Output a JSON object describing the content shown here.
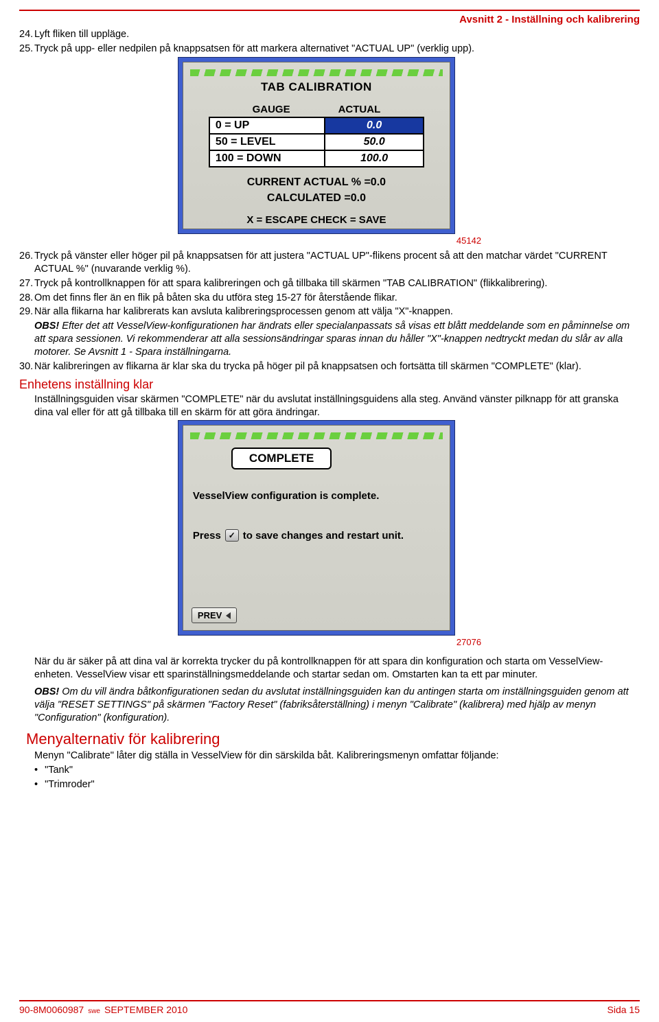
{
  "header": {
    "section_title": "Avsnitt 2 - Inställning och kalibrering"
  },
  "steps_a": [
    {
      "n": "24.",
      "text": "Lyft fliken till uppläge."
    },
    {
      "n": "25.",
      "text": "Tryck på upp- eller nedpilen på knappsatsen för att markera alternativet \"ACTUAL UP\" (verklig upp)."
    }
  ],
  "screen1": {
    "title": "TAB CALIBRATION",
    "col_gauge": "GAUGE",
    "col_actual": "ACTUAL",
    "rows": [
      {
        "left": "0 = UP",
        "right": "0.0",
        "selected": true
      },
      {
        "left": "50 = LEVEL",
        "right": "50.0",
        "selected": false
      },
      {
        "left": "100 = DOWN",
        "right": "100.0",
        "selected": false
      }
    ],
    "line_current": "CURRENT ACTUAL % =0.0",
    "line_calc": "CALCULATED =0.0",
    "footer": "X = ESCAPE  CHECK = SAVE",
    "fig_id": "45142"
  },
  "steps_b": [
    {
      "n": "26.",
      "text": "Tryck på vänster eller höger pil på knappsatsen för att justera \"ACTUAL UP\"-flikens procent så att den matchar värdet \"CURRENT ACTUAL %\" (nuvarande verklig %)."
    },
    {
      "n": "27.",
      "text": "Tryck på kontrollknappen för att spara kalibreringen och gå tillbaka till skärmen \"TAB CALIBRATION\" (flikkalibrering)."
    },
    {
      "n": "28.",
      "text": "Om det finns fler än en flik på båten ska du utföra steg 15-27 för återstående flikar."
    },
    {
      "n": "29.",
      "text": "När alla flikarna har kalibrerats kan avsluta kalibreringsprocessen genom att välja \"X\"-knappen."
    }
  ],
  "note1": {
    "obs": "OBS!",
    "text": " Efter det att VesselView-konfigurationen har ändrats eller specialanpassats så visas ett blått meddelande som en påminnelse om att spara sessionen. Vi rekommenderar att alla sessionsändringar sparas innan du håller \"X\"-knappen nedtryckt medan du slår av alla motorer. Se Avsnitt 1 - Spara inställningarna."
  },
  "step30": {
    "n": "30.",
    "text": "När kalibreringen av flikarna är klar ska du trycka på höger pil på knappsatsen och fortsätta till skärmen \"COMPLETE\" (klar)."
  },
  "h_enhetens": "Enhetens inställning klar",
  "para_enhetens": "Inställningsguiden visar skärmen \"COMPLETE\" när du avslutat inställningsguidens alla steg. Använd vänster pilknapp för att granska dina val eller för att gå tillbaka till en skärm för att göra ändringar.",
  "screen2": {
    "title": "COMPLETE",
    "body": "VesselView configuration is complete.",
    "press": "Press",
    "press_after": "to save changes and restart unit.",
    "prev": "PREV",
    "fig_id": "27076"
  },
  "para_after_complete": "När du är säker på att dina val är korrekta trycker du på kontrollknappen för att spara din konfiguration och starta om VesselView-enheten. VesselView visar ett sparinställningsmeddelande och startar sedan om. Omstarten kan ta ett par minuter.",
  "note2": {
    "obs": "OBS!",
    "text": " Om du vill ändra båtkonfigurationen sedan du avslutat inställningsguiden kan du antingen starta om inställningsguiden genom att välja \"RESET SETTINGS\" på skärmen \"Factory Reset\" (fabriksåterställning) i menyn \"Calibrate\" (kalibrera) med hjälp av menyn \"Configuration\" (konfiguration)."
  },
  "h_menyalt": "Menyalternativ för kalibrering",
  "para_menyalt": "Menyn \"Calibrate\" låter dig ställa in VesselView för din särskilda båt. Kalibreringsmenyn omfattar följande:",
  "bullets": [
    "\"Tank\"",
    "\"Trimroder\""
  ],
  "footer": {
    "docnum": "90-8M0060987",
    "lang": "swe",
    "date": "SEPTEMBER  2010",
    "page_label": "Sida  15"
  }
}
